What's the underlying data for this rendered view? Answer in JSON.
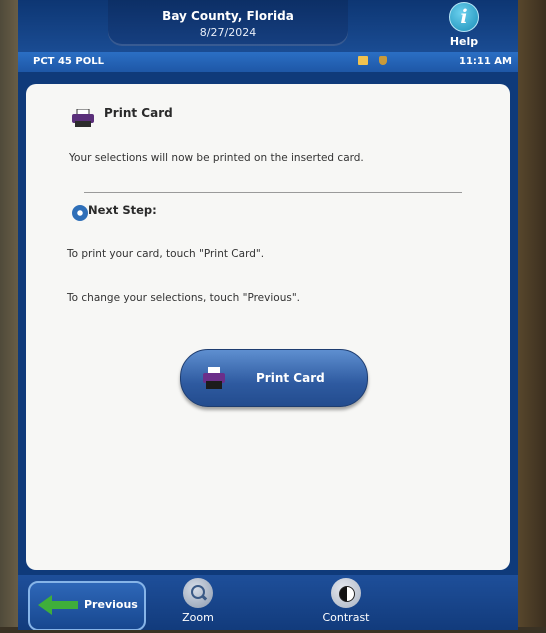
{
  "header": {
    "county": "Bay County, Florida",
    "date": "8/27/2024",
    "help_label": "Help"
  },
  "statusbar": {
    "poll": "PCT 45 POLL",
    "time": "11:11 AM"
  },
  "panel": {
    "title": "Print Card",
    "description": "Your selections will now be printed on the inserted card.",
    "next_step_title": "Next Step:",
    "instruction_print": "To print your card, touch \"Print Card\".",
    "instruction_change": "To change your selections, touch \"Previous\".",
    "print_button_label": "Print Card"
  },
  "bottombar": {
    "previous_label": "Previous",
    "zoom_label": "Zoom",
    "contrast_label": "Contrast"
  },
  "colors": {
    "header_blue": "#0f3a7a",
    "statusbar_blue": "#2b6fc4",
    "button_blue": "#2e5aa0",
    "previous_arrow_green": "#3fae3a"
  },
  "icons": [
    "printer-icon",
    "next-step-gear-icon",
    "help-icon",
    "zoom-icon",
    "contrast-icon",
    "back-arrow-icon",
    "card-status-icon",
    "plug-status-icon"
  ]
}
